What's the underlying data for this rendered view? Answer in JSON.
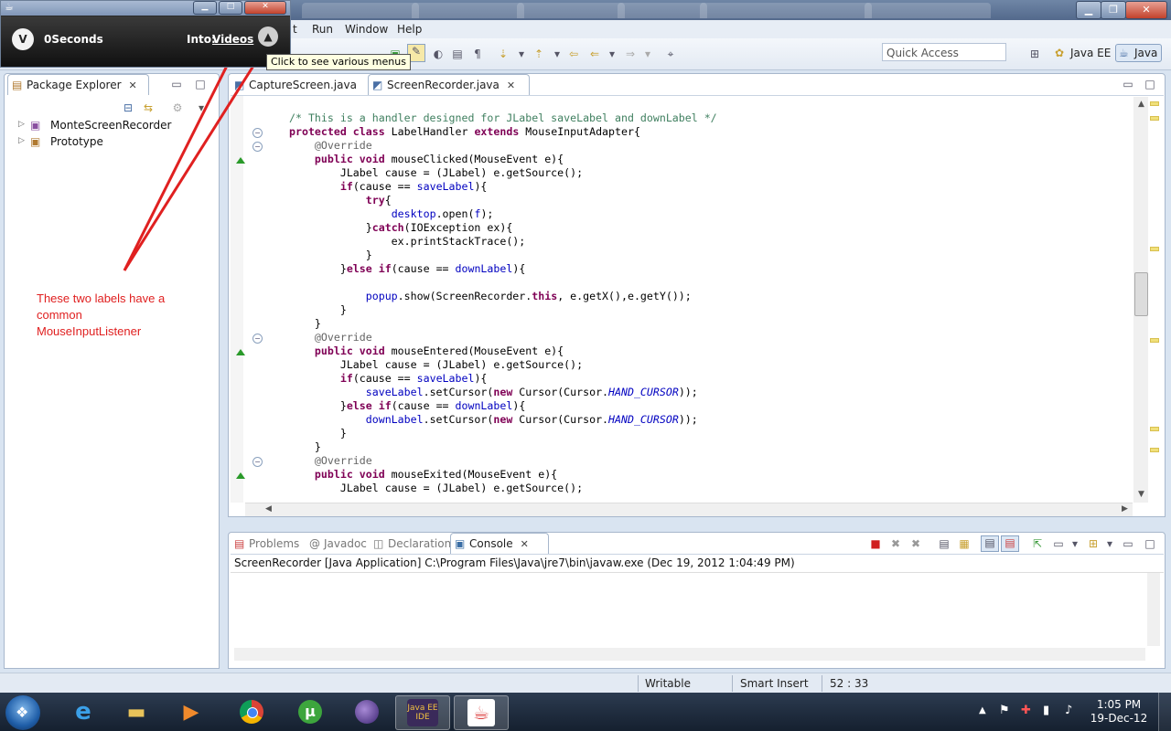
{
  "recorder": {
    "seconds_label": "0Seconds",
    "into_label": "Into:",
    "into_link": "Videos",
    "tooltip": "Click to see various menus"
  },
  "menubar": {
    "items": [
      "Run",
      "Window",
      "Help"
    ],
    "partial": "t"
  },
  "toolbar": {
    "quick_access_placeholder": "Quick Access"
  },
  "perspectives": {
    "java_ee": "Java EE",
    "java": "Java"
  },
  "package_explorer": {
    "title": "Package Explorer",
    "projects": [
      "MonteScreenRecorder",
      "Prototype"
    ]
  },
  "editor": {
    "tabs": [
      "CaptureScreen.java",
      "ScreenRecorder.java"
    ],
    "active_tab": "ScreenRecorder.java"
  },
  "annotation": {
    "note": "These two labels have a common MouseInputListener",
    "color": "#e02020"
  },
  "console_view": {
    "tabs": [
      "Problems",
      "Javadoc",
      "Declaration",
      "Console"
    ],
    "active_tab": "Console",
    "launch_line": "ScreenRecorder [Java Application] C:\\Program Files\\Java\\jre7\\bin\\javaw.exe (Dec 19, 2012 1:04:49 PM)"
  },
  "statusbar": {
    "mode": "Writable",
    "insert": "Smart Insert",
    "position": "52 : 33"
  },
  "taskbar": {
    "time": "1:05 PM",
    "date": "19-Dec-12",
    "java_ee_badge": "Java EE IDE"
  }
}
